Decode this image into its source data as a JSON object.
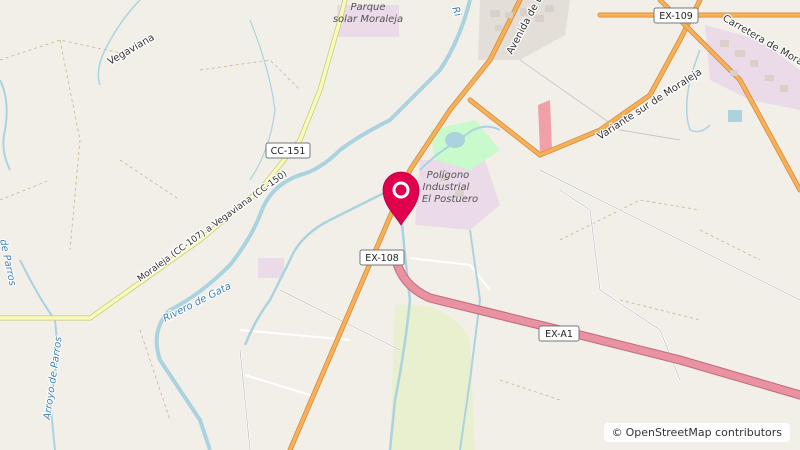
{
  "map": {
    "roads": {
      "ex108": "EX-108",
      "ex_a1": "EX-A1",
      "ex109": "EX-109",
      "cc151": "CC-151",
      "moraleja_vegaviana": "Moraleja (CC-107) a Vegaviana (CC-150)",
      "vegaviana": "Vegaviana",
      "avenida": "Avenida de Lus",
      "variante": "Variante sur de Moraleja",
      "carretera": "Carretera de Moraleja"
    },
    "areas": {
      "parque_line1": "Parque",
      "parque_line2": "solar Moraleja",
      "poligono_line1": "Polígono",
      "poligono_line2": "Industrial",
      "poligono_line3": "El Postuero"
    },
    "water": {
      "rivero": "Rivero de Gata",
      "arroyo": "Arroyo de Parros",
      "parros": "de Parros",
      "river_r": "Ri"
    },
    "marker": {
      "name": "location-pin",
      "color": "#e0004d"
    },
    "attribution": {
      "symbol": "©",
      "text": "OpenStreetMap contributors"
    },
    "colors": {
      "background": "#f2efe9",
      "water": "#aad3df",
      "motorway": "#e892a2",
      "primary_road": "#f6b05a",
      "secondary_road": "#f7fabf",
      "industrial": "#ebdbe8",
      "park": "#c8facc"
    }
  }
}
